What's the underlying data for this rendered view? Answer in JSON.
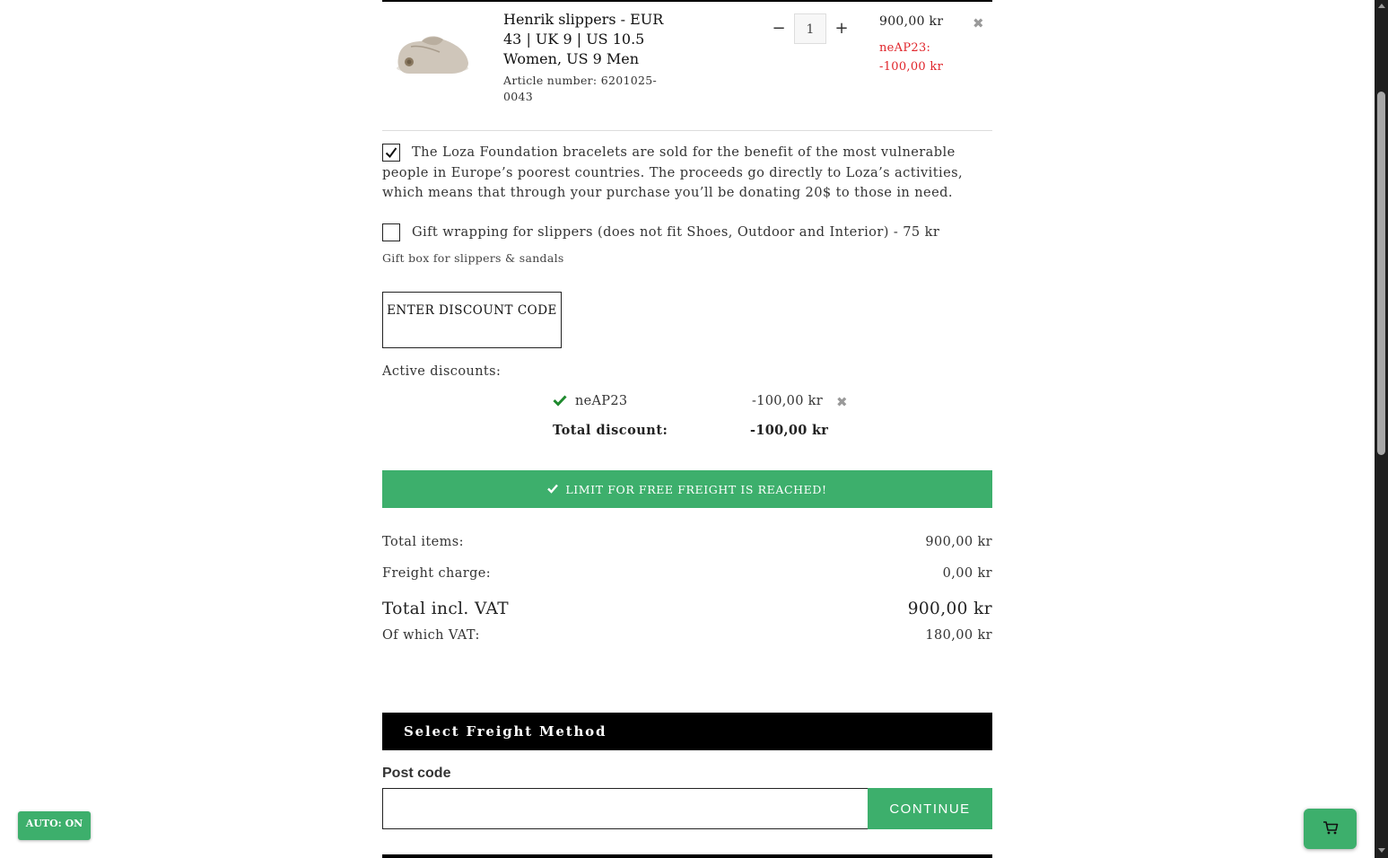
{
  "product": {
    "name": "Henrik slippers - EUR 43 | UK 9 | US 10.5 Women, US 9 Men",
    "article": "Article number: 6201025-0043",
    "quantity": "1",
    "qty_minus": "−",
    "qty_plus": "+",
    "price": "900,00 kr",
    "discount_code": "neAP23:",
    "discount_amount": "-100,00 kr",
    "remove_icon": "close-icon"
  },
  "donation": {
    "checked": true,
    "text": "The Loza Foundation bracelets are sold for the benefit of the most vulnerable people in Europe’s poorest countries. The proceeds go directly to Loza’s activities, which means that through your purchase you’ll be donating 20$ to those in need."
  },
  "gift_wrap": {
    "checked": false,
    "label": "Gift wrapping for slippers (does not fit Shoes, Outdoor and Interior) - 75 kr",
    "sub": "Gift box for slippers & sandals"
  },
  "discount_button": {
    "label": "ENTER DISCOUNT CODE"
  },
  "active_discounts": {
    "label": "Active discounts:",
    "items": [
      {
        "code": "neAP23",
        "amount": "-100,00 kr"
      }
    ],
    "total_label": "Total discount:",
    "total_amount": "-100,00 kr"
  },
  "freight_banner": {
    "text": "LIMIT FOR FREE FREIGHT IS REACHED!",
    "color": "#3daf6c"
  },
  "summary": {
    "total_items_label": "Total items:",
    "total_items_value": "900,00 kr",
    "freight_label": "Freight charge:",
    "freight_value": "0,00 kr",
    "total_label": "Total incl. VAT",
    "total_value": "900,00 kr",
    "vat_label": "Of which VAT:",
    "vat_value": "180,00 kr"
  },
  "freight_method": {
    "header": "Select Freight Method",
    "postcode_label": "Post code",
    "postcode_value": "",
    "continue_label": "CONTINUE"
  },
  "auto_button": {
    "label": "AUTO: ON"
  },
  "cart_button": {
    "icon": "cart-icon"
  },
  "colors": {
    "accent": "#3daf6c",
    "discount_red": "#e0242a",
    "header_bg": "#000000"
  }
}
